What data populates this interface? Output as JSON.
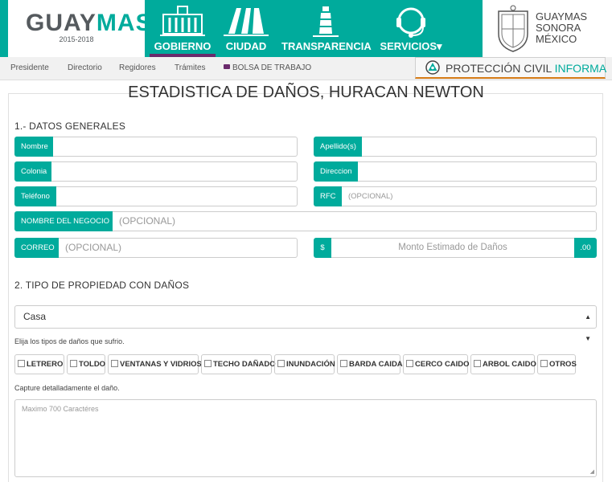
{
  "header": {
    "logo": {
      "part1": "GUAY",
      "part2": "MAS",
      "years": "2015-2018"
    },
    "nav": [
      {
        "label": "GOBIERNO",
        "icon": "city-hall-icon"
      },
      {
        "label": "CIUDAD",
        "icon": "monument-icon"
      },
      {
        "label": "TRANSPARENCIA",
        "icon": "lighthouse-icon"
      },
      {
        "label": "SERVICIOS▾",
        "icon": "headset-icon"
      }
    ],
    "brand": {
      "line1": "GUAYMAS",
      "line2": "SONORA",
      "line3": "MÉXICO"
    }
  },
  "subnav": {
    "items": [
      "Presidente",
      "Directorio",
      "Regidores",
      "Trámites",
      "BOLSA DE TRABAJO"
    ],
    "proteccion": {
      "part1": "PROTECCIÓN CIVIL ",
      "part2": "INFORMA"
    }
  },
  "form": {
    "title": "ESTADISTICA DE DAÑOS, HURACAN NEWTON",
    "section1": "1.- DATOS GENERALES",
    "fields": {
      "nombre": {
        "label": "Nombre",
        "placeholder": ""
      },
      "apellido": {
        "label": "Apellido(s)",
        "placeholder": ""
      },
      "colonia": {
        "label": "Colonia",
        "placeholder": ""
      },
      "direccion": {
        "label": "Direccion",
        "placeholder": ""
      },
      "telefono": {
        "label": "Teléfono",
        "placeholder": ""
      },
      "rfc": {
        "label": "RFC",
        "placeholder": "(OPCIONAL)"
      },
      "negocio": {
        "label": "NOMBRE DEL NEGOCIO",
        "placeholder": "(OPCIONAL)"
      },
      "correo": {
        "label": "CORREO",
        "placeholder": "(OPCIONAL)"
      },
      "monto": {
        "prefix": "$",
        "placeholder": "Monto Estimado de Daños",
        "suffix": ".00"
      }
    },
    "section2": "2. TIPO DE PROPIEDAD CON DAÑOS",
    "property_type": {
      "selected": "Casa"
    },
    "damage_prompt": "Elija los tipos de daños que sufrio.",
    "damage_types": [
      "LETRERO",
      "TOLDO",
      "VENTANAS Y VIDRIOS",
      "TECHO DAÑADO",
      "INUNDACIÓN",
      "BARDA CAIDA",
      "CERCO CAIDO",
      "ARBOL CAIDO",
      "OTROS"
    ],
    "detail_prompt": "Capture detalladamente el daño.",
    "detail_placeholder": "Maximo 700 Caractéres"
  },
  "colors": {
    "accent": "#00ab9c",
    "active_underline": "#6a2a6c",
    "pc_border": "#d57b16"
  }
}
